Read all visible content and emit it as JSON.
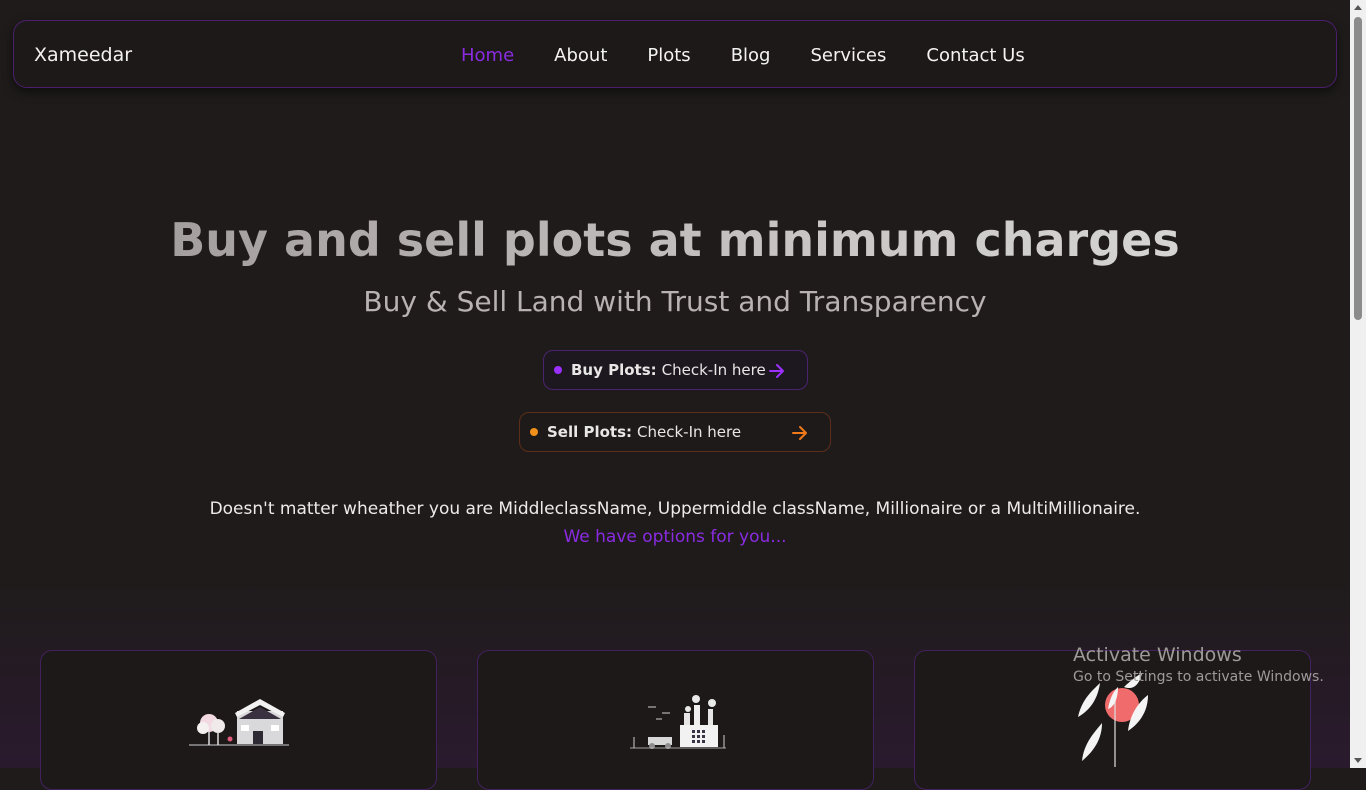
{
  "navbar": {
    "brand": "Xameedar",
    "links": [
      {
        "label": "Home",
        "active": true
      },
      {
        "label": "About",
        "active": false
      },
      {
        "label": "Plots",
        "active": false
      },
      {
        "label": "Blog",
        "active": false
      },
      {
        "label": "Services",
        "active": false
      },
      {
        "label": "Contact Us",
        "active": false
      }
    ]
  },
  "hero": {
    "title": "Buy and sell plots at minimum charges",
    "subtitle": "Buy & Sell Land with Trust and Transparency",
    "buy": {
      "bold": "Buy Plots:",
      "text": "Check-In here"
    },
    "sell": {
      "bold": "Sell Plots:",
      "text": "Check-In here"
    },
    "tagline": "Doesn't matter wheather you are MiddleclassName, Uppermiddle className, Millionaire or a MultiMillionaire.",
    "tagline_accent": "We have options for you..."
  },
  "watermark": {
    "title": "Activate Windows",
    "subtitle": "Go to Settings to activate Windows."
  },
  "colors": {
    "accent_purple": "#8a2be2",
    "accent_orange": "#f0901a",
    "background": "#1f1b1b"
  },
  "icons": {
    "buy_arrow": "arrow-right-icon",
    "sell_arrow": "arrow-right-icon",
    "card_1": "houses-illustration",
    "card_2": "factory-illustration",
    "card_3": "leaves-sun-illustration"
  }
}
